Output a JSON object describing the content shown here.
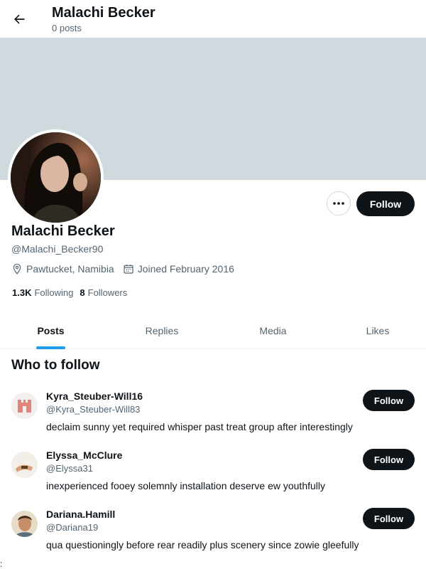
{
  "header": {
    "title": "Malachi Becker",
    "post_count": "0 posts"
  },
  "profile": {
    "name": "Malachi Becker",
    "handle": "@Malachi_Becker90",
    "location": "Pawtucket, Namibia",
    "joined": "Joined February 2016",
    "following_count": "1.3K",
    "following_label": "Following",
    "followers_count": "8",
    "followers_label": "Followers",
    "follow_label": "Follow",
    "banner_color": "#cfd9de"
  },
  "tabs": [
    {
      "label": "Posts",
      "active": true
    },
    {
      "label": "Replies",
      "active": false
    },
    {
      "label": "Media",
      "active": false
    },
    {
      "label": "Likes",
      "active": false
    }
  ],
  "who_to_follow": {
    "title": "Who to follow",
    "items": [
      {
        "name": "Kyra_Steuber-Will16",
        "handle": "@Kyra_Steuber-Will83",
        "bio": "declaim sunny yet required whisper past treat group after interestingly",
        "follow_label": "Follow"
      },
      {
        "name": "Elyssa_McClure",
        "handle": "@Elyssa31",
        "bio": "inexperienced fooey solemnly installation deserve ew youthfully",
        "follow_label": "Follow"
      },
      {
        "name": "Dariana.Hamill",
        "handle": "@Dariana19",
        "bio": "qua questioningly before rear readily plus scenery since zowie gleefully",
        "follow_label": "Follow"
      }
    ]
  },
  "icons": [
    "back-arrow-icon",
    "more-icon",
    "location-icon",
    "calendar-icon"
  ],
  "colors": {
    "accent": "#1d9bf0",
    "button": "#0f1419",
    "secondary_text": "#536471"
  },
  "stray_mark": ":"
}
